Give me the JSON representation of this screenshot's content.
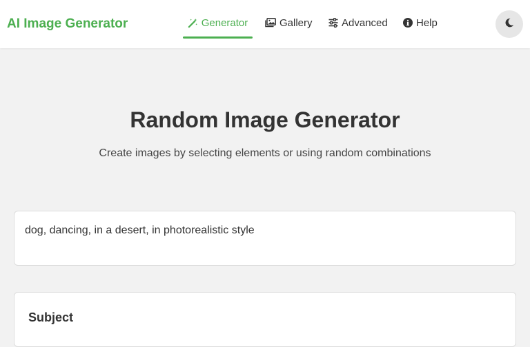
{
  "header": {
    "brand": "AI Image Generator",
    "nav": [
      {
        "label": "Generator",
        "icon": "magic-wand-icon",
        "active": true
      },
      {
        "label": "Gallery",
        "icon": "images-icon",
        "active": false
      },
      {
        "label": "Advanced",
        "icon": "sliders-icon",
        "active": false
      },
      {
        "label": "Help",
        "icon": "info-circle-icon",
        "active": false
      }
    ],
    "theme_toggle_icon": "moon-icon"
  },
  "main": {
    "title": "Random Image Generator",
    "subtitle": "Create images by selecting elements or using random combinations",
    "prompt": "dog, dancing, in a desert, in photorealistic style",
    "sections": [
      {
        "heading": "Subject"
      }
    ]
  },
  "colors": {
    "accent": "#4caf50",
    "background": "#f2f2f2",
    "card": "#ffffff"
  }
}
